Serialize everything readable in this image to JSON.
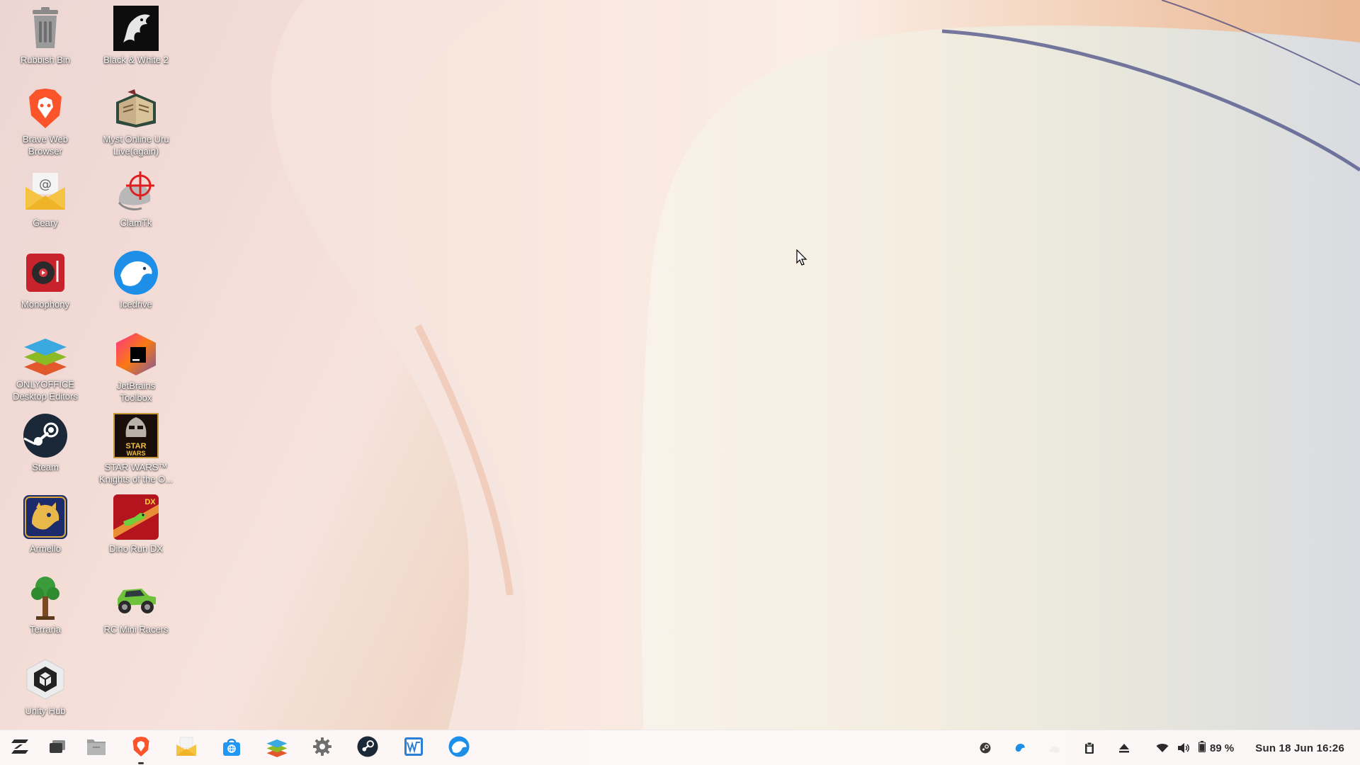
{
  "desktop": {
    "icons": [
      {
        "label": "Rubbish Bin",
        "icon": "trash-icon"
      },
      {
        "label": "Black & White 2",
        "icon": "black-white-2-icon"
      },
      {
        "label": "Brave Web\nBrowser",
        "icon": "brave-icon"
      },
      {
        "label": "Myst Online Uru\nLive(again)",
        "icon": "myst-icon"
      },
      {
        "label": "Geary",
        "icon": "geary-mail-icon"
      },
      {
        "label": "ClamTk",
        "icon": "clamtk-icon"
      },
      {
        "label": "Monophony",
        "icon": "monophony-icon"
      },
      {
        "label": "Icedrive",
        "icon": "icedrive-icon"
      },
      {
        "label": "ONLYOFFICE\nDesktop Editors",
        "icon": "onlyoffice-icon"
      },
      {
        "label": "JetBrains\nToolbox",
        "icon": "jetbrains-toolbox-icon"
      },
      {
        "label": "Steam",
        "icon": "steam-icon"
      },
      {
        "label": "STAR WARS™\nKnights of the O...",
        "icon": "kotor2-icon"
      },
      {
        "label": "Armello",
        "icon": "armello-icon"
      },
      {
        "label": "Dino Run DX",
        "icon": "dino-run-icon"
      },
      {
        "label": "Terraria",
        "icon": "terraria-icon"
      },
      {
        "label": "RC Mini Racers",
        "icon": "rc-mini-racers-icon"
      },
      {
        "label": "Unity Hub",
        "icon": "unity-hub-icon"
      }
    ]
  },
  "taskbar": {
    "apps": [
      {
        "name": "zorin-menu",
        "icon": "zorin-logo-icon"
      },
      {
        "name": "workspaces",
        "icon": "workspaces-icon"
      },
      {
        "name": "files",
        "icon": "files-icon"
      },
      {
        "name": "brave",
        "icon": "brave-icon",
        "running": true
      },
      {
        "name": "geary",
        "icon": "geary-mail-icon"
      },
      {
        "name": "software",
        "icon": "software-store-icon"
      },
      {
        "name": "onlyoffice",
        "icon": "onlyoffice-icon"
      },
      {
        "name": "settings",
        "icon": "gear-icon"
      },
      {
        "name": "steam",
        "icon": "steam-icon"
      },
      {
        "name": "system-monitor",
        "icon": "system-monitor-icon"
      },
      {
        "name": "icedrive",
        "icon": "icedrive-icon"
      }
    ],
    "tray": {
      "battery_percent": "89 %",
      "battery_level": 0.89,
      "clock": "Sun 18 Jun  16:26",
      "icons": [
        "steam-tray-icon",
        "icedrive-tray-icon",
        "cloud-icon",
        "clipboard-icon",
        "eject-icon",
        "wifi-icon",
        "volume-icon",
        "battery-icon"
      ]
    }
  }
}
